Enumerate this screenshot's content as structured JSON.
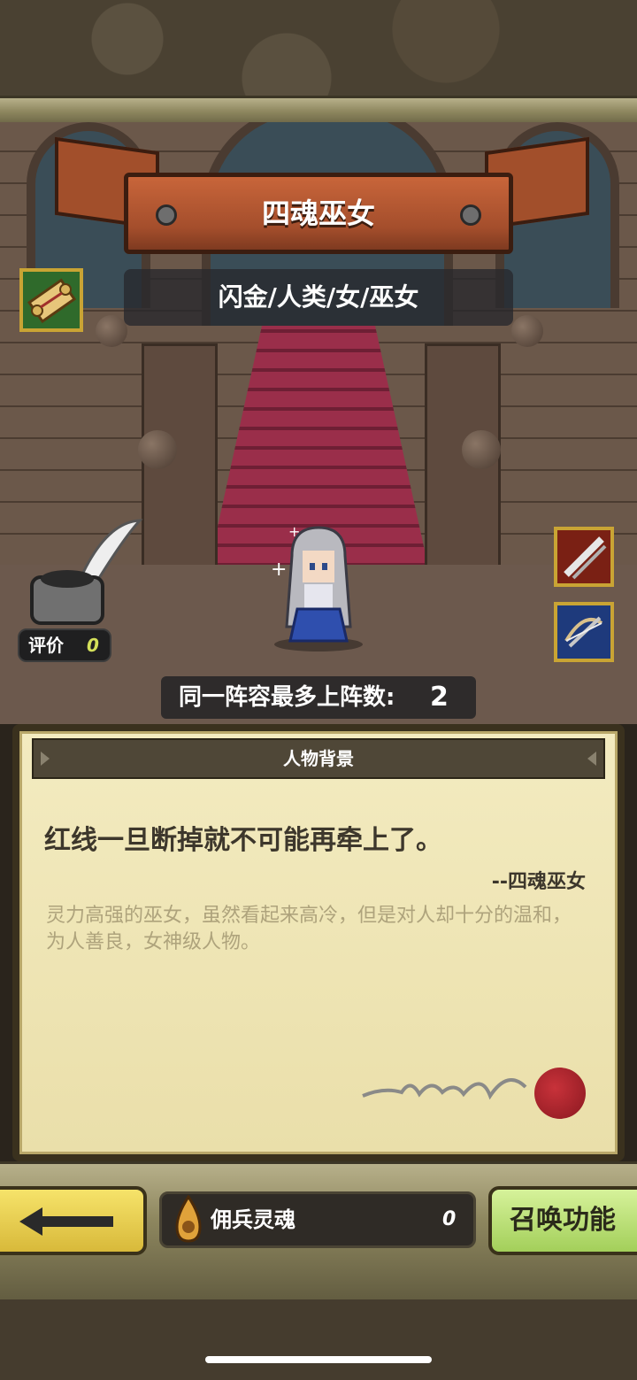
{
  "hero": {
    "name": "四魂巫女",
    "traits": "闪金/人类/女/巫女"
  },
  "rating": {
    "label": "评价",
    "value": "0"
  },
  "deploy": {
    "label": "同一阵容最多上阵数:",
    "value": "2"
  },
  "background_panel": {
    "title": "人物背景",
    "quote": "红线一旦断掉就不可能再牵上了。",
    "quote_author": "--四魂巫女",
    "description": "灵力高强的巫女，虽然看起来高冷，但是对人却十分的温和，为人善良，女神级人物。"
  },
  "currency": {
    "label": "佣兵灵魂",
    "value": "0"
  },
  "buttons": {
    "summon": "召唤功能"
  },
  "icons": {
    "lore": "scroll-icon",
    "skill_1": "slash-icon",
    "skill_2": "crossbow-icon",
    "back": "arrow-left-icon",
    "soul": "soul-flame-icon"
  },
  "colors": {
    "banner": "#a44e2c",
    "parchment": "#eadfaa",
    "back_button": "#f6e36a",
    "summon_button": "#a3cf5a",
    "rating_value": "#d4e05a"
  }
}
